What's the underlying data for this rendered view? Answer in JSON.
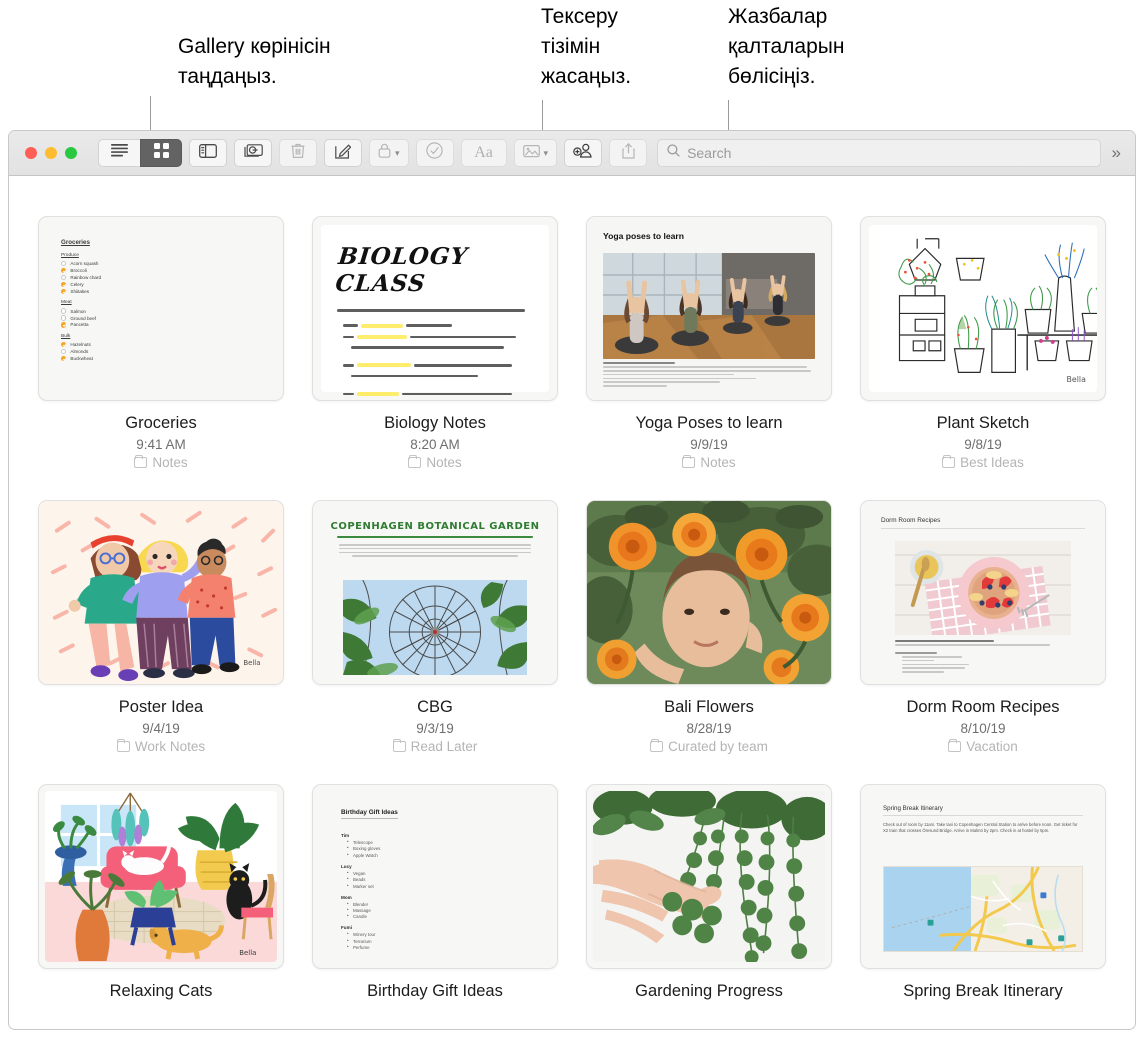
{
  "callouts": [
    {
      "text": "Gallery көрінісін таңдаңыз.",
      "target": "gallery-view-button"
    },
    {
      "text": "Тексеру тізімін жасаңыз.",
      "target": "checklist-button"
    },
    {
      "text": "Жазбалар қалталарын бөлісіңіз.",
      "target": "share-folder-button"
    }
  ],
  "toolbar": {
    "buttons": [
      {
        "name": "list-view-button",
        "icon": "list-view-icon",
        "state": "inactive"
      },
      {
        "name": "gallery-view-button",
        "icon": "gallery-grid-icon",
        "state": "active"
      },
      {
        "name": "sidebar-toggle-button",
        "icon": "sidebar-icon",
        "state": "inactive"
      },
      {
        "name": "attachment-browser-button",
        "icon": "attachments-icon",
        "state": "inactive"
      },
      {
        "name": "delete-button",
        "icon": "trash-icon",
        "state": "disabled"
      },
      {
        "name": "compose-button",
        "icon": "compose-pencil-icon",
        "state": "inactive"
      },
      {
        "name": "lock-button",
        "icon": "lock-icon",
        "state": "disabled",
        "caret": true
      },
      {
        "name": "checklist-button",
        "icon": "checkmark-circle-icon",
        "state": "disabled"
      },
      {
        "name": "format-button",
        "icon": "aa-text-icon",
        "state": "disabled",
        "label": "Aa"
      },
      {
        "name": "media-button",
        "icon": "photo-icon",
        "state": "disabled",
        "caret": true
      },
      {
        "name": "share-folder-button",
        "icon": "add-person-icon",
        "state": "inactive"
      },
      {
        "name": "share-button",
        "icon": "share-export-icon",
        "state": "disabled"
      }
    ],
    "search_placeholder": "Search",
    "search_value": "",
    "overflow_label": "»"
  },
  "gallery": {
    "notes": [
      {
        "title": "Groceries",
        "date": "9:41 AM",
        "folder": "Notes",
        "thumb": "checklist",
        "content": {
          "heading": "Groceries",
          "sections": [
            {
              "label": "Produce",
              "items": [
                {
                  "text": "Acorn squash",
                  "checked": false
                },
                {
                  "text": "Broccoli",
                  "checked": true
                },
                {
                  "text": "Rainbow chard",
                  "checked": false
                },
                {
                  "text": "Celery",
                  "checked": true
                },
                {
                  "text": "Shiitakes",
                  "checked": true
                }
              ]
            },
            {
              "label": "Meat",
              "items": [
                {
                  "text": "Salmon",
                  "checked": false
                },
                {
                  "text": "Ground beef",
                  "checked": false
                },
                {
                  "text": "Pancetta",
                  "checked": true
                }
              ]
            },
            {
              "label": "Bulk",
              "items": [
                {
                  "text": "Hazelnuts",
                  "checked": true
                },
                {
                  "text": "Almonds",
                  "checked": false
                },
                {
                  "text": "Buckwheat",
                  "checked": true
                }
              ]
            }
          ]
        }
      },
      {
        "title": "Biology Notes",
        "date": "8:20 AM",
        "folder": "Notes",
        "thumb": "handwriting",
        "content": {
          "heading": "BIOLOGY CLASS"
        }
      },
      {
        "title": "Yoga Poses to learn",
        "date": "9/9/19",
        "folder": "Notes",
        "thumb": "yoga",
        "content": {
          "heading": "Yoga poses to learn"
        }
      },
      {
        "title": "Plant Sketch",
        "date": "9/8/19",
        "folder": "Best Ideas",
        "thumb": "plants",
        "content": {}
      },
      {
        "title": "Poster Idea",
        "date": "9/4/19",
        "folder": "Work Notes",
        "thumb": "poster",
        "content": {}
      },
      {
        "title": "CBG",
        "date": "9/3/19",
        "folder": "Read Later",
        "thumb": "cbg",
        "content": {
          "heading": "COPENHAGEN BOTANICAL GARDEN"
        }
      },
      {
        "title": "Bali Flowers",
        "date": "8/28/19",
        "folder": "Curated by team",
        "thumb": "marigold",
        "content": {}
      },
      {
        "title": "Dorm Room Recipes",
        "date": "8/10/19",
        "folder": "Vacation",
        "thumb": "recipe",
        "content": {
          "heading": "Dorm Room Recipes"
        }
      },
      {
        "title": "Relaxing Cats",
        "date": "",
        "folder": "",
        "thumb": "cats",
        "content": {}
      },
      {
        "title": "Birthday Gift Ideas",
        "date": "",
        "folder": "",
        "thumb": "giftlist",
        "content": {
          "heading": "Birthday Gift Ideas",
          "groups": [
            {
              "name": "Tim",
              "items": [
                "Telescope",
                "Boxing gloves",
                "Apple Watch"
              ]
            },
            {
              "name": "Lucy",
              "items": [
                "Vegan",
                "Beads",
                "Marker set"
              ]
            },
            {
              "name": "Mom",
              "items": [
                "Blender",
                "Massage",
                "Candle"
              ]
            },
            {
              "name": "Fumi",
              "items": [
                "Winery tour",
                "Terrarium",
                "Perfume"
              ]
            }
          ]
        }
      },
      {
        "title": "Gardening Progress",
        "date": "",
        "folder": "",
        "thumb": "succulent",
        "content": {}
      },
      {
        "title": "Spring Break Itinerary",
        "date": "",
        "folder": "",
        "thumb": "itinerary",
        "content": {
          "heading": "Spring Break Itinerary",
          "body": "Check out of room by 11am. Take taxi to Copenhagen Central Station to arrive before noon. Get ticket for X2 train that crosses Öresund Bridge. Arrive in Malmö by 2pm. Check in at hostel by 5pm."
        }
      }
    ]
  },
  "colors": {
    "accent_orange": "#f5a623",
    "active_button": "#636363",
    "title_text": "#1c1c1c",
    "date_text": "#6e6e6e",
    "folder_text": "#b4b4b4"
  }
}
